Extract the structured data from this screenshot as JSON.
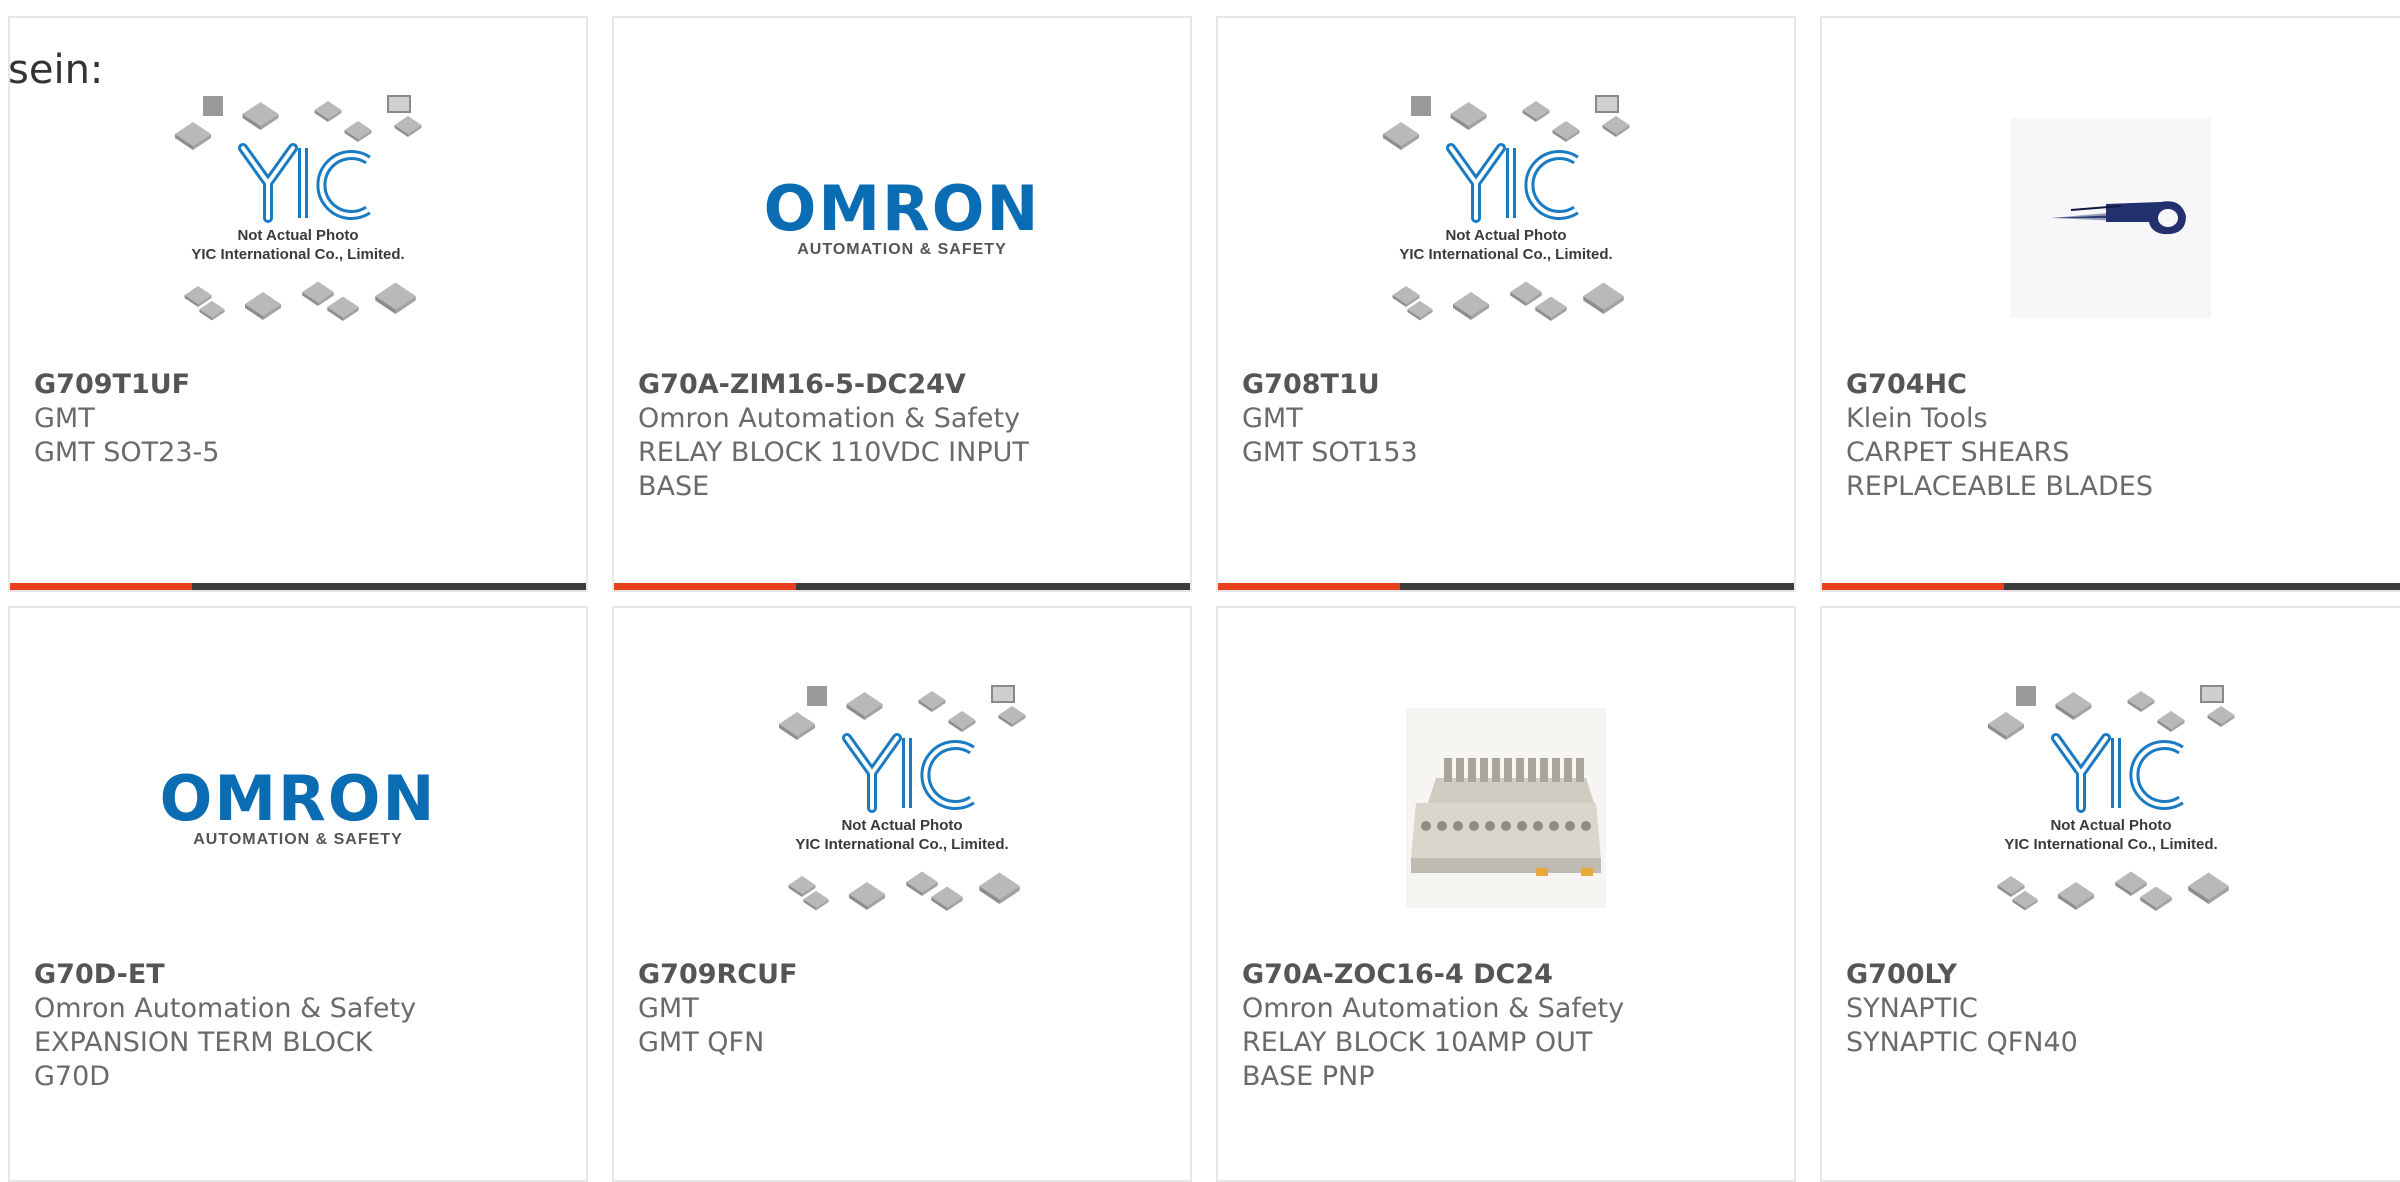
{
  "intro_text": "sein:",
  "brand_colors": {
    "accent": "#e8411c",
    "bar": "#3c3c3c",
    "omron_blue": "#0a6cb3",
    "yic_blue": "#1a7bc2"
  },
  "placeholder": {
    "line1": "Not Actual Photo",
    "line2": "YIC International Co., Limited."
  },
  "omron_logo": {
    "word": "OMRON",
    "tagline": "AUTOMATION & SAFETY"
  },
  "products": [
    {
      "part": "G709T1UF",
      "manufacturer": "GMT",
      "description": "GMT SOT23-5",
      "image": "yic-placeholder"
    },
    {
      "part": "G70A-ZIM16-5-DC24V",
      "manufacturer": "Omron Automation & Safety",
      "description": "RELAY BLOCK 110VDC INPUT BASE",
      "image": "omron-logo"
    },
    {
      "part": "G708T1U",
      "manufacturer": "GMT",
      "description": "GMT SOT153",
      "image": "yic-placeholder"
    },
    {
      "part": "G704HC",
      "manufacturer": "Klein Tools",
      "description": "CARPET SHEARS REPLACEABLE BLADES",
      "image": "shears-photo"
    },
    {
      "part": "G70D-ET",
      "manufacturer": "Omron Automation & Safety",
      "description": "EXPANSION TERM BLOCK G70D",
      "image": "omron-logo"
    },
    {
      "part": "G709RCUF",
      "manufacturer": "GMT",
      "description": "GMT QFN",
      "image": "yic-placeholder"
    },
    {
      "part": "G70A-ZOC16-4 DC24",
      "manufacturer": "Omron Automation & Safety",
      "description": "RELAY BLOCK 10AMP OUT BASE PNP",
      "image": "relay-block-photo"
    },
    {
      "part": "G700LY",
      "manufacturer": "SYNAPTIC",
      "description": "SYNAPTIC QFN40",
      "image": "yic-placeholder"
    }
  ]
}
